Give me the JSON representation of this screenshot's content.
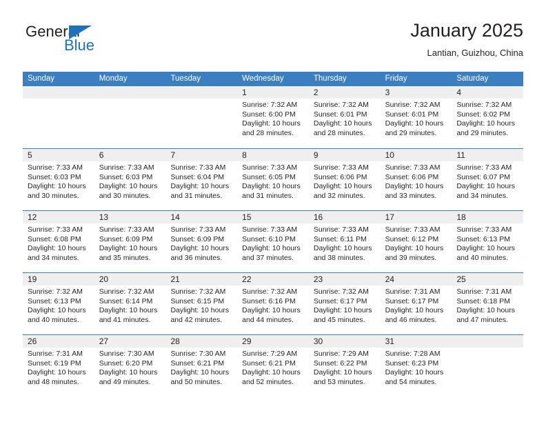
{
  "brand": {
    "logo_word_1": "General",
    "logo_word_2": "Blue",
    "logo_icon": "triangle-flag-icon",
    "accent_color": "#1f72b8"
  },
  "header": {
    "title": "January 2025",
    "subtitle": "Lantian, Guizhou, China"
  },
  "calendar": {
    "header_bg": "#3c7fc1",
    "daynum_band_bg": "#efefef",
    "weekdays": [
      "Sunday",
      "Monday",
      "Tuesday",
      "Wednesday",
      "Thursday",
      "Friday",
      "Saturday"
    ],
    "weeks": [
      [
        {
          "day": "",
          "lines": []
        },
        {
          "day": "",
          "lines": []
        },
        {
          "day": "",
          "lines": []
        },
        {
          "day": "1",
          "lines": [
            "Sunrise: 7:32 AM",
            "Sunset: 6:00 PM",
            "Daylight: 10 hours",
            "and 28 minutes."
          ]
        },
        {
          "day": "2",
          "lines": [
            "Sunrise: 7:32 AM",
            "Sunset: 6:01 PM",
            "Daylight: 10 hours",
            "and 28 minutes."
          ]
        },
        {
          "day": "3",
          "lines": [
            "Sunrise: 7:32 AM",
            "Sunset: 6:01 PM",
            "Daylight: 10 hours",
            "and 29 minutes."
          ]
        },
        {
          "day": "4",
          "lines": [
            "Sunrise: 7:32 AM",
            "Sunset: 6:02 PM",
            "Daylight: 10 hours",
            "and 29 minutes."
          ]
        }
      ],
      [
        {
          "day": "5",
          "lines": [
            "Sunrise: 7:33 AM",
            "Sunset: 6:03 PM",
            "Daylight: 10 hours",
            "and 30 minutes."
          ]
        },
        {
          "day": "6",
          "lines": [
            "Sunrise: 7:33 AM",
            "Sunset: 6:03 PM",
            "Daylight: 10 hours",
            "and 30 minutes."
          ]
        },
        {
          "day": "7",
          "lines": [
            "Sunrise: 7:33 AM",
            "Sunset: 6:04 PM",
            "Daylight: 10 hours",
            "and 31 minutes."
          ]
        },
        {
          "day": "8",
          "lines": [
            "Sunrise: 7:33 AM",
            "Sunset: 6:05 PM",
            "Daylight: 10 hours",
            "and 31 minutes."
          ]
        },
        {
          "day": "9",
          "lines": [
            "Sunrise: 7:33 AM",
            "Sunset: 6:06 PM",
            "Daylight: 10 hours",
            "and 32 minutes."
          ]
        },
        {
          "day": "10",
          "lines": [
            "Sunrise: 7:33 AM",
            "Sunset: 6:06 PM",
            "Daylight: 10 hours",
            "and 33 minutes."
          ]
        },
        {
          "day": "11",
          "lines": [
            "Sunrise: 7:33 AM",
            "Sunset: 6:07 PM",
            "Daylight: 10 hours",
            "and 34 minutes."
          ]
        }
      ],
      [
        {
          "day": "12",
          "lines": [
            "Sunrise: 7:33 AM",
            "Sunset: 6:08 PM",
            "Daylight: 10 hours",
            "and 34 minutes."
          ]
        },
        {
          "day": "13",
          "lines": [
            "Sunrise: 7:33 AM",
            "Sunset: 6:09 PM",
            "Daylight: 10 hours",
            "and 35 minutes."
          ]
        },
        {
          "day": "14",
          "lines": [
            "Sunrise: 7:33 AM",
            "Sunset: 6:09 PM",
            "Daylight: 10 hours",
            "and 36 minutes."
          ]
        },
        {
          "day": "15",
          "lines": [
            "Sunrise: 7:33 AM",
            "Sunset: 6:10 PM",
            "Daylight: 10 hours",
            "and 37 minutes."
          ]
        },
        {
          "day": "16",
          "lines": [
            "Sunrise: 7:33 AM",
            "Sunset: 6:11 PM",
            "Daylight: 10 hours",
            "and 38 minutes."
          ]
        },
        {
          "day": "17",
          "lines": [
            "Sunrise: 7:33 AM",
            "Sunset: 6:12 PM",
            "Daylight: 10 hours",
            "and 39 minutes."
          ]
        },
        {
          "day": "18",
          "lines": [
            "Sunrise: 7:33 AM",
            "Sunset: 6:13 PM",
            "Daylight: 10 hours",
            "and 40 minutes."
          ]
        }
      ],
      [
        {
          "day": "19",
          "lines": [
            "Sunrise: 7:32 AM",
            "Sunset: 6:13 PM",
            "Daylight: 10 hours",
            "and 40 minutes."
          ]
        },
        {
          "day": "20",
          "lines": [
            "Sunrise: 7:32 AM",
            "Sunset: 6:14 PM",
            "Daylight: 10 hours",
            "and 41 minutes."
          ]
        },
        {
          "day": "21",
          "lines": [
            "Sunrise: 7:32 AM",
            "Sunset: 6:15 PM",
            "Daylight: 10 hours",
            "and 42 minutes."
          ]
        },
        {
          "day": "22",
          "lines": [
            "Sunrise: 7:32 AM",
            "Sunset: 6:16 PM",
            "Daylight: 10 hours",
            "and 44 minutes."
          ]
        },
        {
          "day": "23",
          "lines": [
            "Sunrise: 7:32 AM",
            "Sunset: 6:17 PM",
            "Daylight: 10 hours",
            "and 45 minutes."
          ]
        },
        {
          "day": "24",
          "lines": [
            "Sunrise: 7:31 AM",
            "Sunset: 6:17 PM",
            "Daylight: 10 hours",
            "and 46 minutes."
          ]
        },
        {
          "day": "25",
          "lines": [
            "Sunrise: 7:31 AM",
            "Sunset: 6:18 PM",
            "Daylight: 10 hours",
            "and 47 minutes."
          ]
        }
      ],
      [
        {
          "day": "26",
          "lines": [
            "Sunrise: 7:31 AM",
            "Sunset: 6:19 PM",
            "Daylight: 10 hours",
            "and 48 minutes."
          ]
        },
        {
          "day": "27",
          "lines": [
            "Sunrise: 7:30 AM",
            "Sunset: 6:20 PM",
            "Daylight: 10 hours",
            "and 49 minutes."
          ]
        },
        {
          "day": "28",
          "lines": [
            "Sunrise: 7:30 AM",
            "Sunset: 6:21 PM",
            "Daylight: 10 hours",
            "and 50 minutes."
          ]
        },
        {
          "day": "29",
          "lines": [
            "Sunrise: 7:29 AM",
            "Sunset: 6:21 PM",
            "Daylight: 10 hours",
            "and 52 minutes."
          ]
        },
        {
          "day": "30",
          "lines": [
            "Sunrise: 7:29 AM",
            "Sunset: 6:22 PM",
            "Daylight: 10 hours",
            "and 53 minutes."
          ]
        },
        {
          "day": "31",
          "lines": [
            "Sunrise: 7:28 AM",
            "Sunset: 6:23 PM",
            "Daylight: 10 hours",
            "and 54 minutes."
          ]
        },
        {
          "day": "",
          "lines": []
        }
      ]
    ]
  }
}
